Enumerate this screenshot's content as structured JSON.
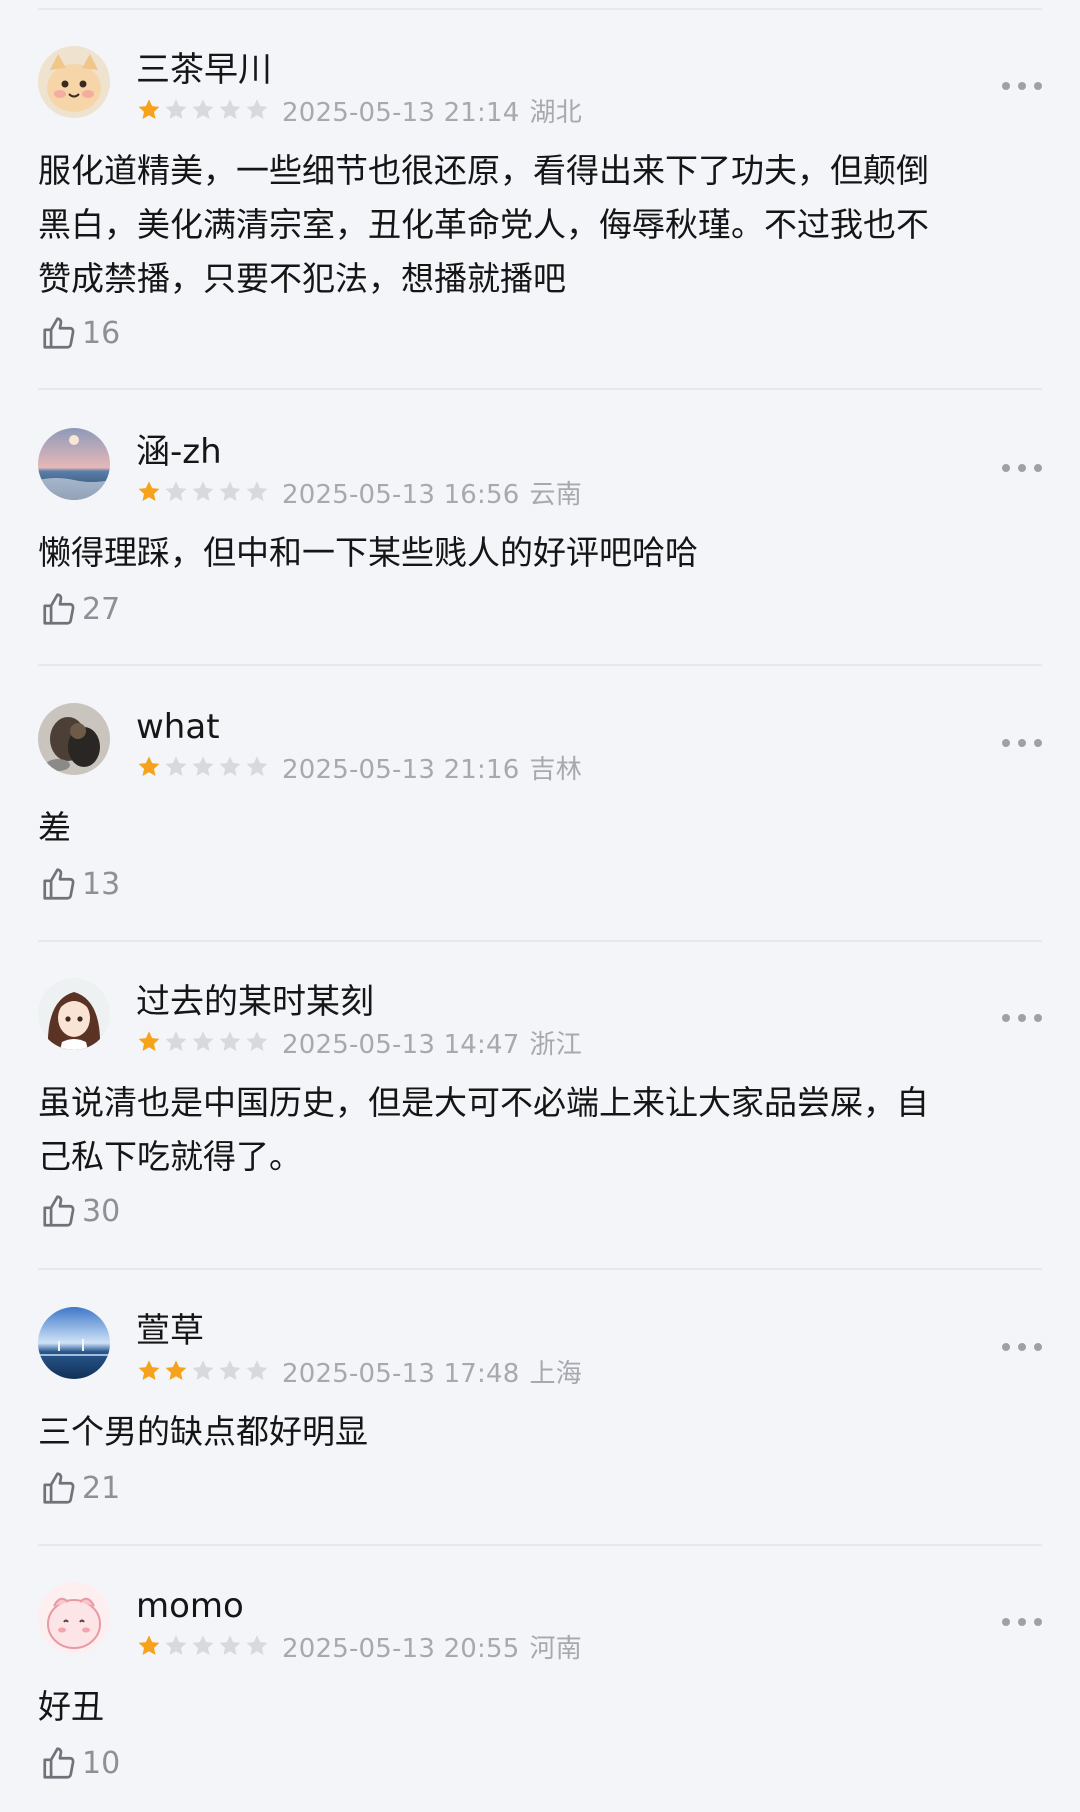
{
  "comments": [
    {
      "user": "三茶早川",
      "avatar": "cat-avatar",
      "rating": 1,
      "date": "2025-05-13 21:14",
      "location": "湖北",
      "text": "服化道精美，一些细节也很还原，看得出来下了功夫，但颠倒\n黑白，美化满清宗室，丑化革命党人，侮辱秋瑾。不过我也不\n赞成禁播，只要不犯法，想播就播吧",
      "likes": "16"
    },
    {
      "user": "涵-zh",
      "avatar": "sunset-sea-avatar",
      "rating": 1,
      "date": "2025-05-13 16:56",
      "location": "云南",
      "text": "懒得理踩，但中和一下某些贱人的好评吧哈哈",
      "likes": "27"
    },
    {
      "user": "what",
      "avatar": "animal-photo-avatar",
      "rating": 1,
      "date": "2025-05-13 21:16",
      "location": "吉林",
      "text": "差",
      "likes": "13"
    },
    {
      "user": "过去的某时某刻",
      "avatar": "anime-girl-avatar",
      "rating": 1,
      "date": "2025-05-13 14:47",
      "location": "浙江",
      "text": "虽说清也是中国历史，但是大可不必端上来让大家品尝屎，自\n己私下吃就得了。",
      "likes": "30"
    },
    {
      "user": "萱草",
      "avatar": "sea-landscape-avatar",
      "rating": 2,
      "date": "2025-05-13 17:48",
      "location": "上海",
      "text": "三个男的缺点都好明显",
      "likes": "21"
    },
    {
      "user": "momo",
      "avatar": "pink-cartoon-avatar",
      "rating": 1,
      "date": "2025-05-13 20:55",
      "location": "河南",
      "text": "好丑",
      "likes": "10"
    }
  ],
  "colors": {
    "background": "#f3f5f9",
    "star_filled": "#f6a21b",
    "star_empty": "#d7d9dd",
    "meta_text": "#a6a9ae"
  },
  "icons": {
    "more": "more-dots-icon",
    "like": "thumbs-up-icon",
    "star": "star-icon"
  }
}
